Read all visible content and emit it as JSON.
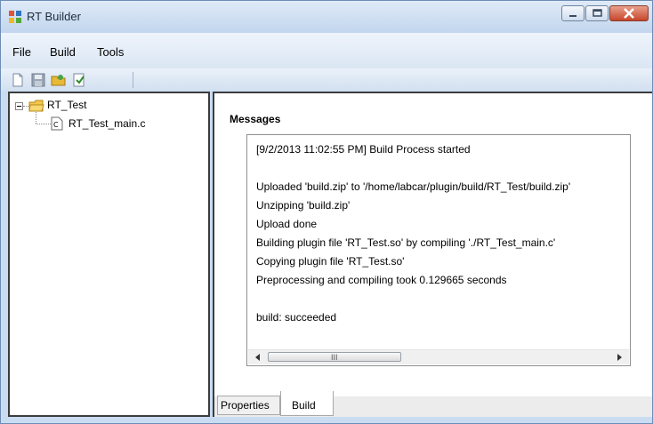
{
  "window": {
    "title": "RT Builder",
    "accent_colors": {
      "titlebar": "#c9dcf2",
      "close_button": "#c7462b"
    }
  },
  "menu": {
    "items": [
      "File",
      "Build",
      "Tools"
    ]
  },
  "toolbar": {
    "icons": [
      "new-file-icon",
      "save-icon",
      "open-project-icon",
      "build-icon"
    ]
  },
  "tree": {
    "root": {
      "label": "RT_Test",
      "icon": "folder-icon",
      "expanded": true
    },
    "children": [
      {
        "label": "RT_Test_main.c",
        "icon": "c-file-icon"
      }
    ]
  },
  "messages": {
    "title": "Messages",
    "lines": [
      "[9/2/2013 11:02:55 PM] Build Process started",
      "",
      "Uploaded 'build.zip' to '/home/labcar/plugin/build/RT_Test/build.zip'",
      "Unzipping 'build.zip'",
      "Upload done",
      "Building plugin file 'RT_Test.so' by compiling './RT_Test_main.c'",
      "Copying plugin file 'RT_Test.so'",
      "Preprocessing and compiling took 0.129665 seconds",
      "",
      "build: succeeded"
    ],
    "scroll_grip": "III"
  },
  "tabs": {
    "properties": "Properties",
    "build": "Build",
    "active": "Build"
  }
}
